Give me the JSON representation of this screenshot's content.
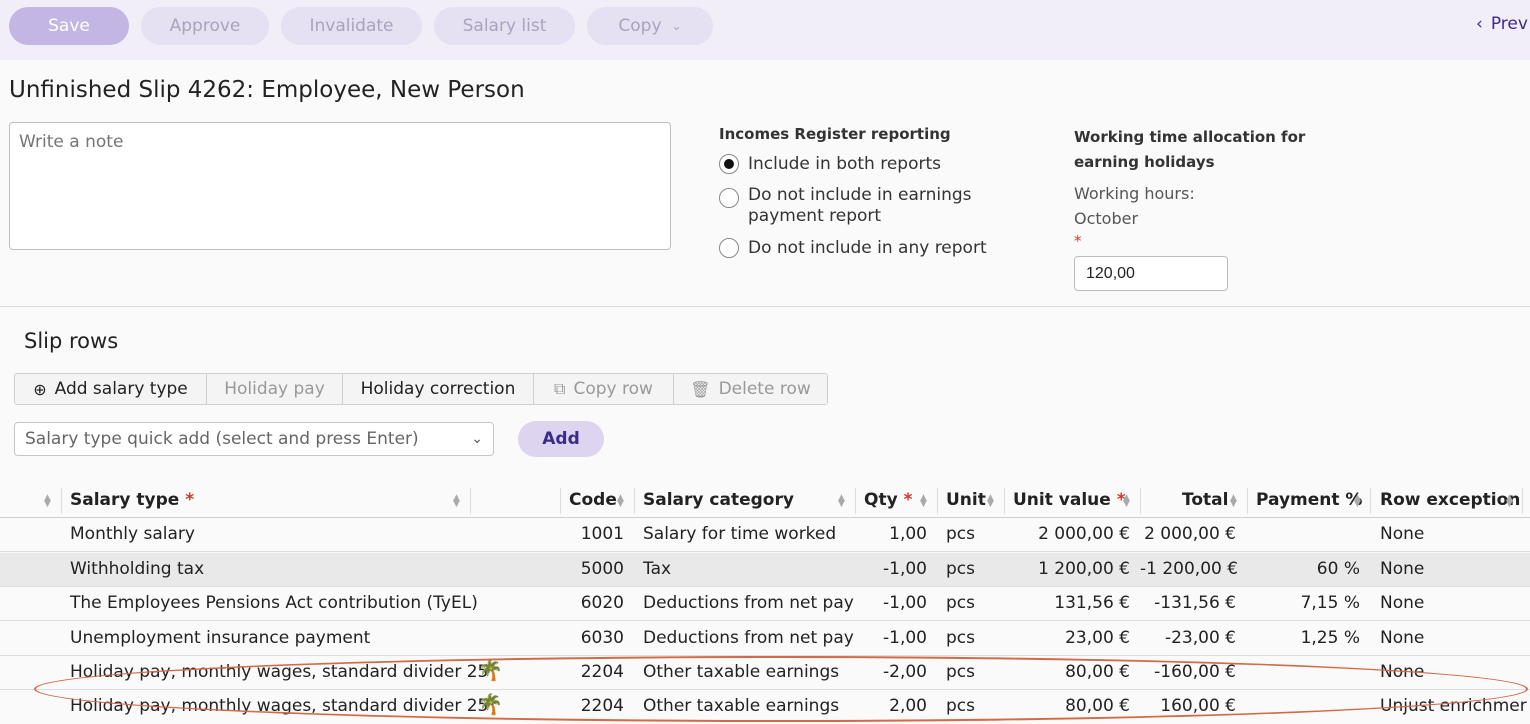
{
  "toolbar": {
    "buttons": [
      {
        "label": "Save"
      },
      {
        "label": "Approve"
      },
      {
        "label": "Invalidate"
      },
      {
        "label": "Salary list"
      },
      {
        "label": "Copy"
      }
    ],
    "prev_label": "Prev"
  },
  "page_title": "Unfinished Slip 4262: Employee, New Person",
  "note": {
    "placeholder": "Write a note"
  },
  "incomes_register": {
    "title": "Incomes Register reporting",
    "options": [
      {
        "label": "Include in both reports",
        "selected": true
      },
      {
        "label": "Do not include in earnings payment report",
        "selected": false
      },
      {
        "label": "Do not include in any report",
        "selected": false
      }
    ]
  },
  "working_time": {
    "title": "Working time allocation for earning holidays",
    "hours_label": "Working hours:",
    "month": "October",
    "required_mark": "*",
    "hours_value": "120,00"
  },
  "slip_rows": {
    "title": "Slip rows",
    "actions": [
      {
        "label": "Add salary type",
        "icon": "plus-circle-icon",
        "enabled": true
      },
      {
        "label": "Holiday pay",
        "enabled": false
      },
      {
        "label": "Holiday correction",
        "enabled": true
      },
      {
        "label": "Copy row",
        "icon": "copy-icon",
        "enabled": false
      },
      {
        "label": "Delete row",
        "icon": "trash-icon",
        "enabled": false
      }
    ],
    "quick_add_placeholder": "Salary type quick add (select and press Enter)",
    "add_label": "Add"
  },
  "table": {
    "columns": {
      "salary_type": "Salary type",
      "code": "Code",
      "category": "Salary category",
      "qty": "Qty",
      "unit": "Unit",
      "unit_value": "Unit value",
      "total": "Total",
      "payment_pct": "Payment %",
      "row_exception": "Row exception"
    },
    "required_mark": "*",
    "rows": [
      {
        "type": "Monthly salary",
        "code": "1001",
        "category": "Salary for time worked",
        "qty": "1,00",
        "unit": "pcs",
        "unit_value": "2 000,00 €",
        "total": "2 000,00 €",
        "pct": "",
        "exception": "None",
        "holiday_icon": false
      },
      {
        "type": "Withholding tax",
        "code": "5000",
        "category": "Tax",
        "qty": "-1,00",
        "unit": "pcs",
        "unit_value": "1 200,00 €",
        "total": "-1 200,00 €",
        "pct": "60 %",
        "exception": "None",
        "holiday_icon": false
      },
      {
        "type": "The Employees Pensions Act contribution (TyEL)",
        "code": "6020",
        "category": "Deductions from net pay",
        "qty": "-1,00",
        "unit": "pcs",
        "unit_value": "131,56 €",
        "total": "-131,56 €",
        "pct": "7,15 %",
        "exception": "None",
        "holiday_icon": false
      },
      {
        "type": "Unemployment insurance payment",
        "code": "6030",
        "category": "Deductions from net pay",
        "qty": "-1,00",
        "unit": "pcs",
        "unit_value": "23,00 €",
        "total": "-23,00 €",
        "pct": "1,25 %",
        "exception": "None",
        "holiday_icon": false
      },
      {
        "type": "Holiday pay, monthly wages, standard divider 25",
        "code": "2204",
        "category": "Other taxable earnings",
        "qty": "-2,00",
        "unit": "pcs",
        "unit_value": "80,00 €",
        "total": "-160,00 €",
        "pct": "",
        "exception": "None",
        "holiday_icon": true
      },
      {
        "type": "Holiday pay, monthly wages, standard divider 25",
        "code": "2204",
        "category": "Other taxable earnings",
        "qty": "2,00",
        "unit": "pcs",
        "unit_value": "80,00 €",
        "total": "160,00 €",
        "pct": "",
        "exception": "Unjust enrichmer",
        "holiday_icon": true
      }
    ]
  },
  "colors": {
    "accent": "#3a2b8a",
    "toolbar_bg": "#f1eef8",
    "annotation": "#d26a47"
  }
}
